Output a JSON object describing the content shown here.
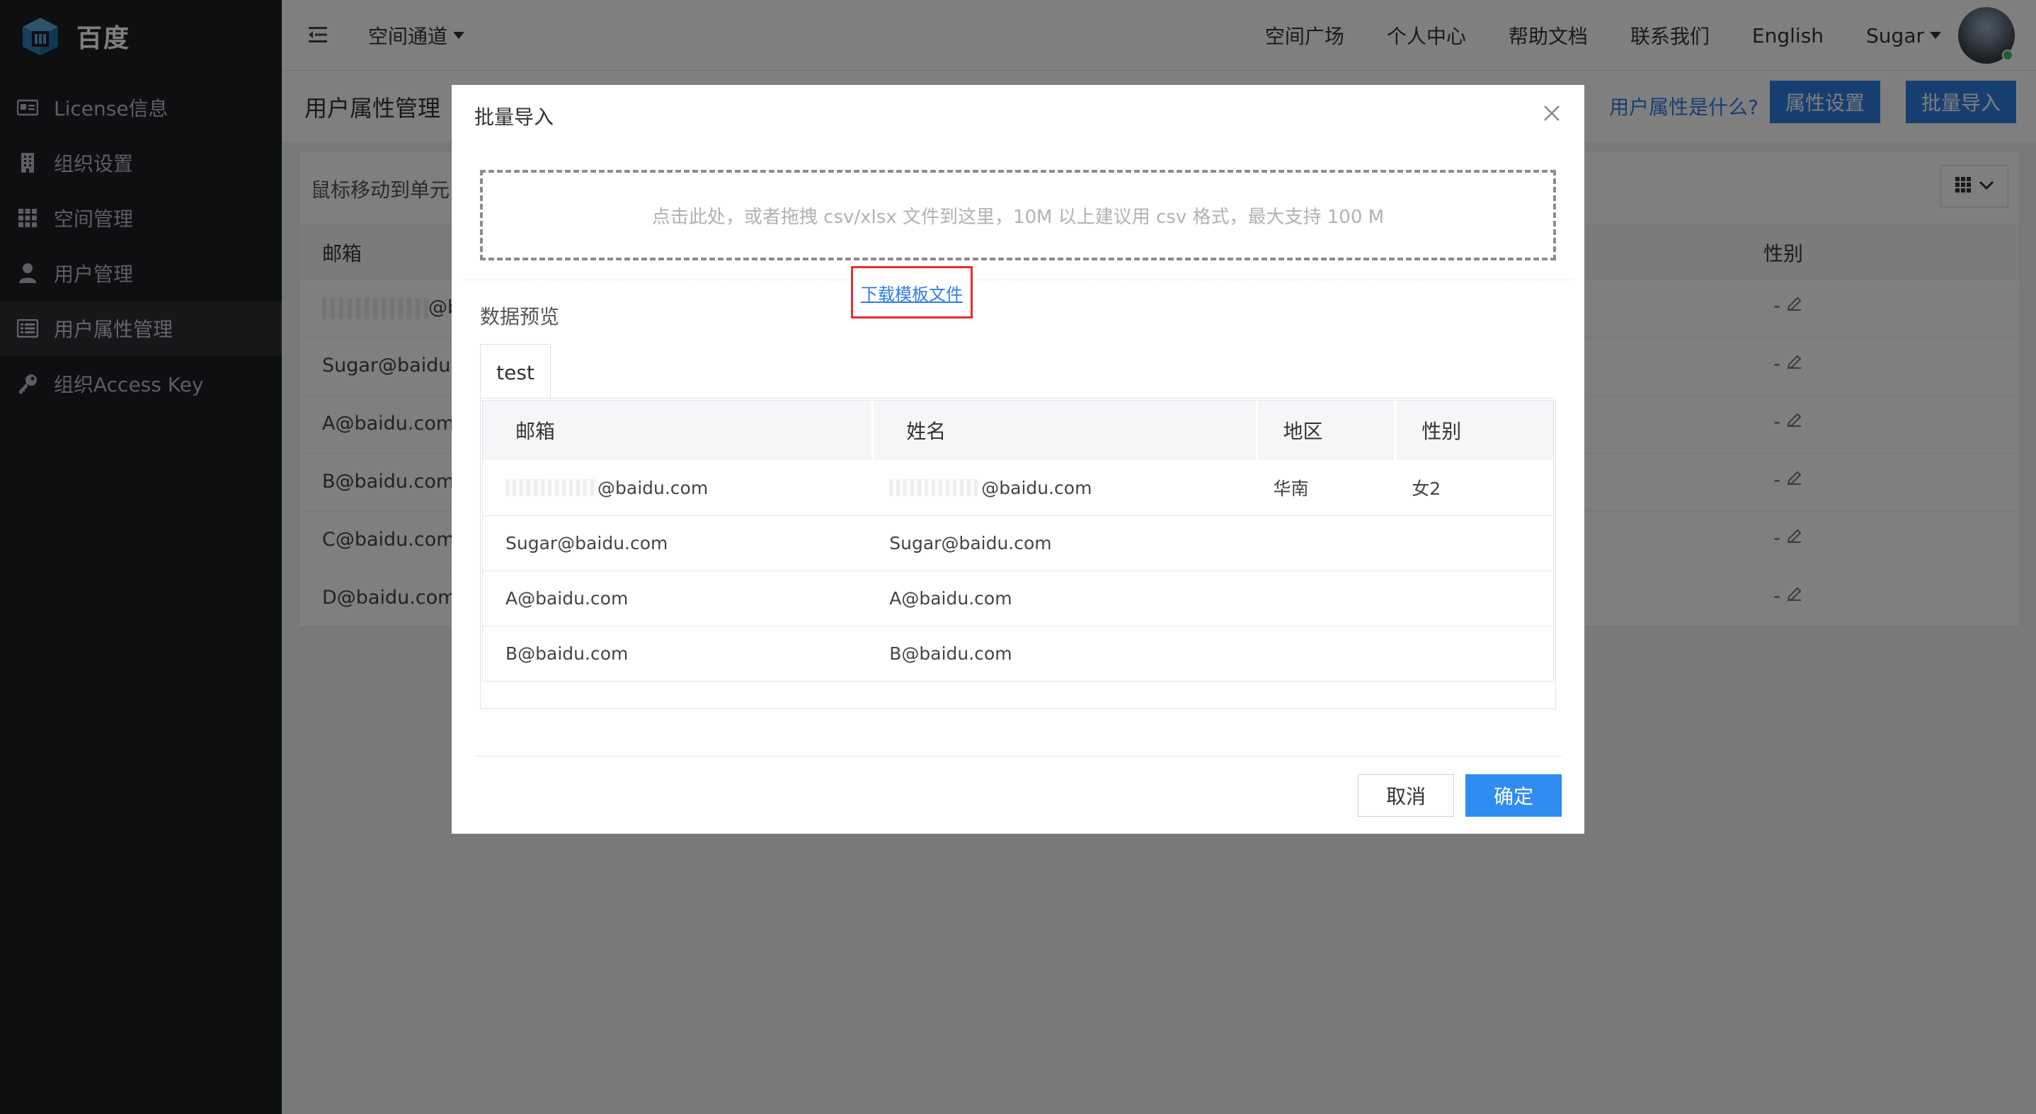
{
  "brand": {
    "name": "百度"
  },
  "sidebar": {
    "items": [
      {
        "label": "License信息",
        "icon": "license-card-icon"
      },
      {
        "label": "组织设置",
        "icon": "building-icon"
      },
      {
        "label": "空间管理",
        "icon": "grid-icon"
      },
      {
        "label": "用户管理",
        "icon": "user-icon"
      },
      {
        "label": "用户属性管理",
        "icon": "list-icon",
        "active": true
      },
      {
        "label": "组织Access Key",
        "icon": "key-icon"
      }
    ]
  },
  "topbar": {
    "space_select": "空间通道",
    "links": [
      "空间广场",
      "个人中心",
      "帮助文档",
      "联系我们",
      "English"
    ],
    "user": "Sugar"
  },
  "page": {
    "title": "用户属性管理",
    "help_link": "用户属性是什么?",
    "attr_button": "属性设置",
    "import_button": "批量导入"
  },
  "bg_table": {
    "toolbar_text": "鼠标移动到单元",
    "headers": {
      "email": "邮箱",
      "gender": "性别"
    },
    "rows": [
      {
        "email": "@ba",
        "gender": "-"
      },
      {
        "email": "Sugar@baidu.c",
        "gender": "-"
      },
      {
        "email": "A@baidu.com",
        "gender": "-"
      },
      {
        "email": "B@baidu.com",
        "gender": "-"
      },
      {
        "email": "C@baidu.com",
        "gender": "-"
      },
      {
        "email": "D@baidu.com",
        "gender": "-"
      }
    ]
  },
  "modal": {
    "title": "批量导入",
    "upload_hint": "点击此处，或者拖拽 csv/xlsx 文件到这里，10M 以上建议用 csv 格式，最大支持 100 M",
    "download_template": "下载模板文件",
    "preview_label": "数据预览",
    "sheet_tab": "test",
    "preview": {
      "headers": [
        "邮箱",
        "姓名",
        "地区",
        "性别"
      ],
      "rows": [
        [
          "@baidu.com",
          "@baidu.com",
          "华南",
          "女2"
        ],
        [
          "Sugar@baidu.com",
          "Sugar@baidu.com",
          "",
          ""
        ],
        [
          "A@baidu.com",
          "A@baidu.com",
          "",
          ""
        ],
        [
          "B@baidu.com",
          "B@baidu.com",
          "",
          ""
        ]
      ]
    },
    "cancel": "取消",
    "confirm": "确定"
  },
  "colors": {
    "primary": "#2f7de1",
    "sidebar_bg": "#1b1e23",
    "highlight_border": "#e0322d"
  }
}
